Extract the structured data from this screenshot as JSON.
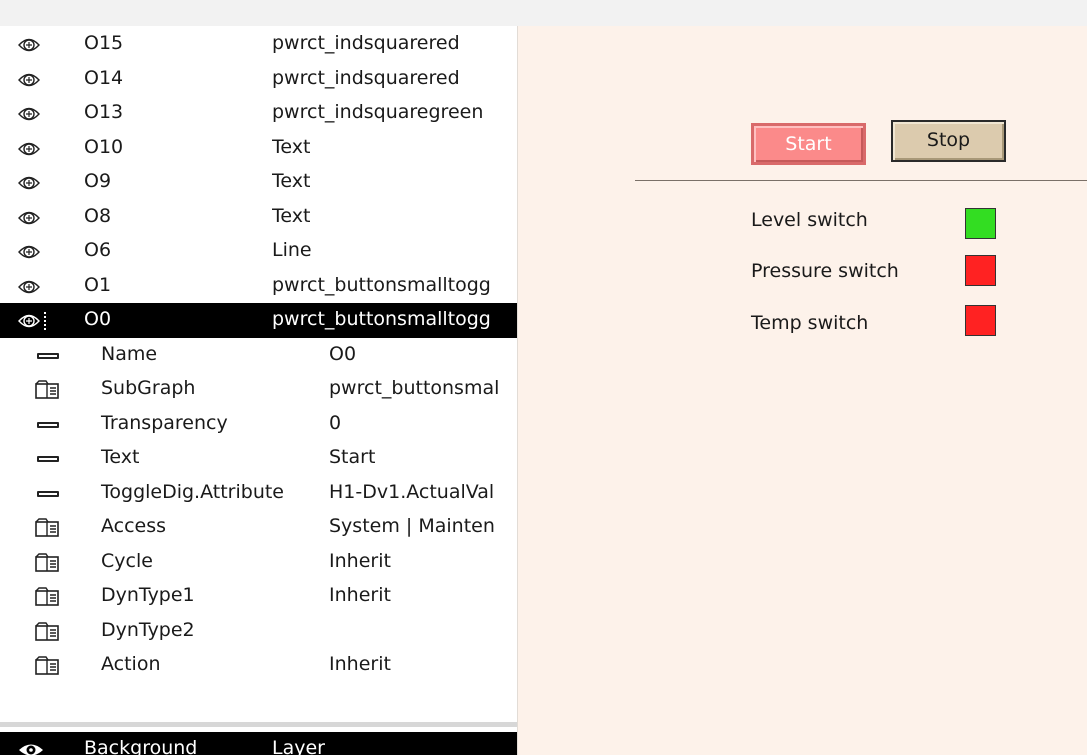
{
  "objects": [
    {
      "name": "O15",
      "class": "pwrct_indsquarered"
    },
    {
      "name": "O14",
      "class": "pwrct_indsquarered"
    },
    {
      "name": "O13",
      "class": "pwrct_indsquaregreen"
    },
    {
      "name": "O10",
      "class": "Text"
    },
    {
      "name": "O9",
      "class": "Text"
    },
    {
      "name": "O8",
      "class": "Text"
    },
    {
      "name": "O6",
      "class": "Line"
    },
    {
      "name": "O1",
      "class": "pwrct_buttonsmalltogg"
    },
    {
      "name": "O0",
      "class": "pwrct_buttonsmalltogg"
    }
  ],
  "attributes": [
    {
      "icon": "dash",
      "name": "Name",
      "value": "O0"
    },
    {
      "icon": "folder",
      "name": "SubGraph",
      "value": "pwrct_buttonsmal"
    },
    {
      "icon": "dash",
      "name": "Transparency",
      "value": "0"
    },
    {
      "icon": "dash",
      "name": "Text",
      "value": "Start"
    },
    {
      "icon": "dash",
      "name": "ToggleDig.Attribute",
      "value": "H1-Dv1.ActualVal"
    },
    {
      "icon": "folder",
      "name": "Access",
      "value": "System | Mainten"
    },
    {
      "icon": "folder",
      "name": "Cycle",
      "value": "Inherit"
    },
    {
      "icon": "folder",
      "name": "DynType1",
      "value": "Inherit"
    },
    {
      "icon": "folder",
      "name": "DynType2",
      "value": ""
    },
    {
      "icon": "folder",
      "name": "Action",
      "value": "Inherit"
    }
  ],
  "layer": {
    "name": "Background",
    "type": "Layer"
  },
  "graph": {
    "start_label": "Start",
    "stop_label": "Stop",
    "switches": [
      {
        "label": "Level switch",
        "color": "#33dd22"
      },
      {
        "label": "Pressure switch",
        "color": "#ff2222"
      },
      {
        "label": "Temp switch",
        "color": "#ff2222"
      }
    ]
  },
  "colors": {
    "selection": "#000000",
    "canvas_bg": "#fdf2ea",
    "start_button": "#fb8a8a",
    "stop_button": "#dccbae"
  }
}
